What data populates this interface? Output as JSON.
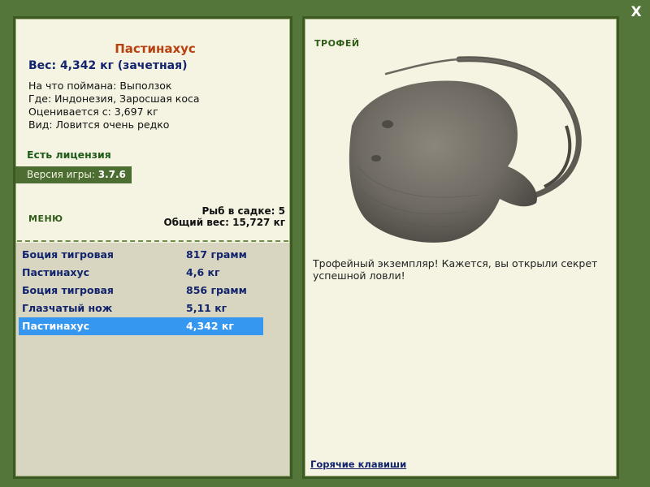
{
  "close_label": "X",
  "fish": {
    "title": "Пастинахус",
    "weight_line": "Вес: 4,342 кг (зачетная)",
    "caught_on": "На что поймана: Выползок",
    "location": "Где: Индонезия, Заросшая коса",
    "valued_from": "Оценивается с: 3,697 кг",
    "rarity": "Вид: Ловится очень редко"
  },
  "license": "Есть лицензия",
  "version": {
    "label": "Версия игры:",
    "value": "3.7.6"
  },
  "menu_label": "МЕНЮ",
  "cage": {
    "count_line": "Рыб в садке: 5",
    "total_line": "Общий вес: 15,727 кг"
  },
  "catch_list": [
    {
      "name": "Боция тигровая",
      "weight": "817 грамм",
      "selected": false
    },
    {
      "name": "Пастинахус",
      "weight": "4,6 кг",
      "selected": false
    },
    {
      "name": "Боция тигровая",
      "weight": "856 грамм",
      "selected": false
    },
    {
      "name": "Глазчатый нож",
      "weight": "5,11 кг",
      "selected": false
    },
    {
      "name": "Пастинахус",
      "weight": "4,342 кг",
      "selected": true
    }
  ],
  "trophy": {
    "label": "ТРОФЕЙ",
    "text": "Трофейный экземпляр! Кажется, вы открыли секрет успешной ловли!"
  },
  "hotkeys_label": "Горячие клавиши",
  "colors": {
    "background": "#55763a",
    "panel": "#f5f3e1",
    "title_accent": "#b8410f",
    "text_navy": "#12246d",
    "selection": "#3597f0",
    "list_bg": "#d8d6c0"
  }
}
